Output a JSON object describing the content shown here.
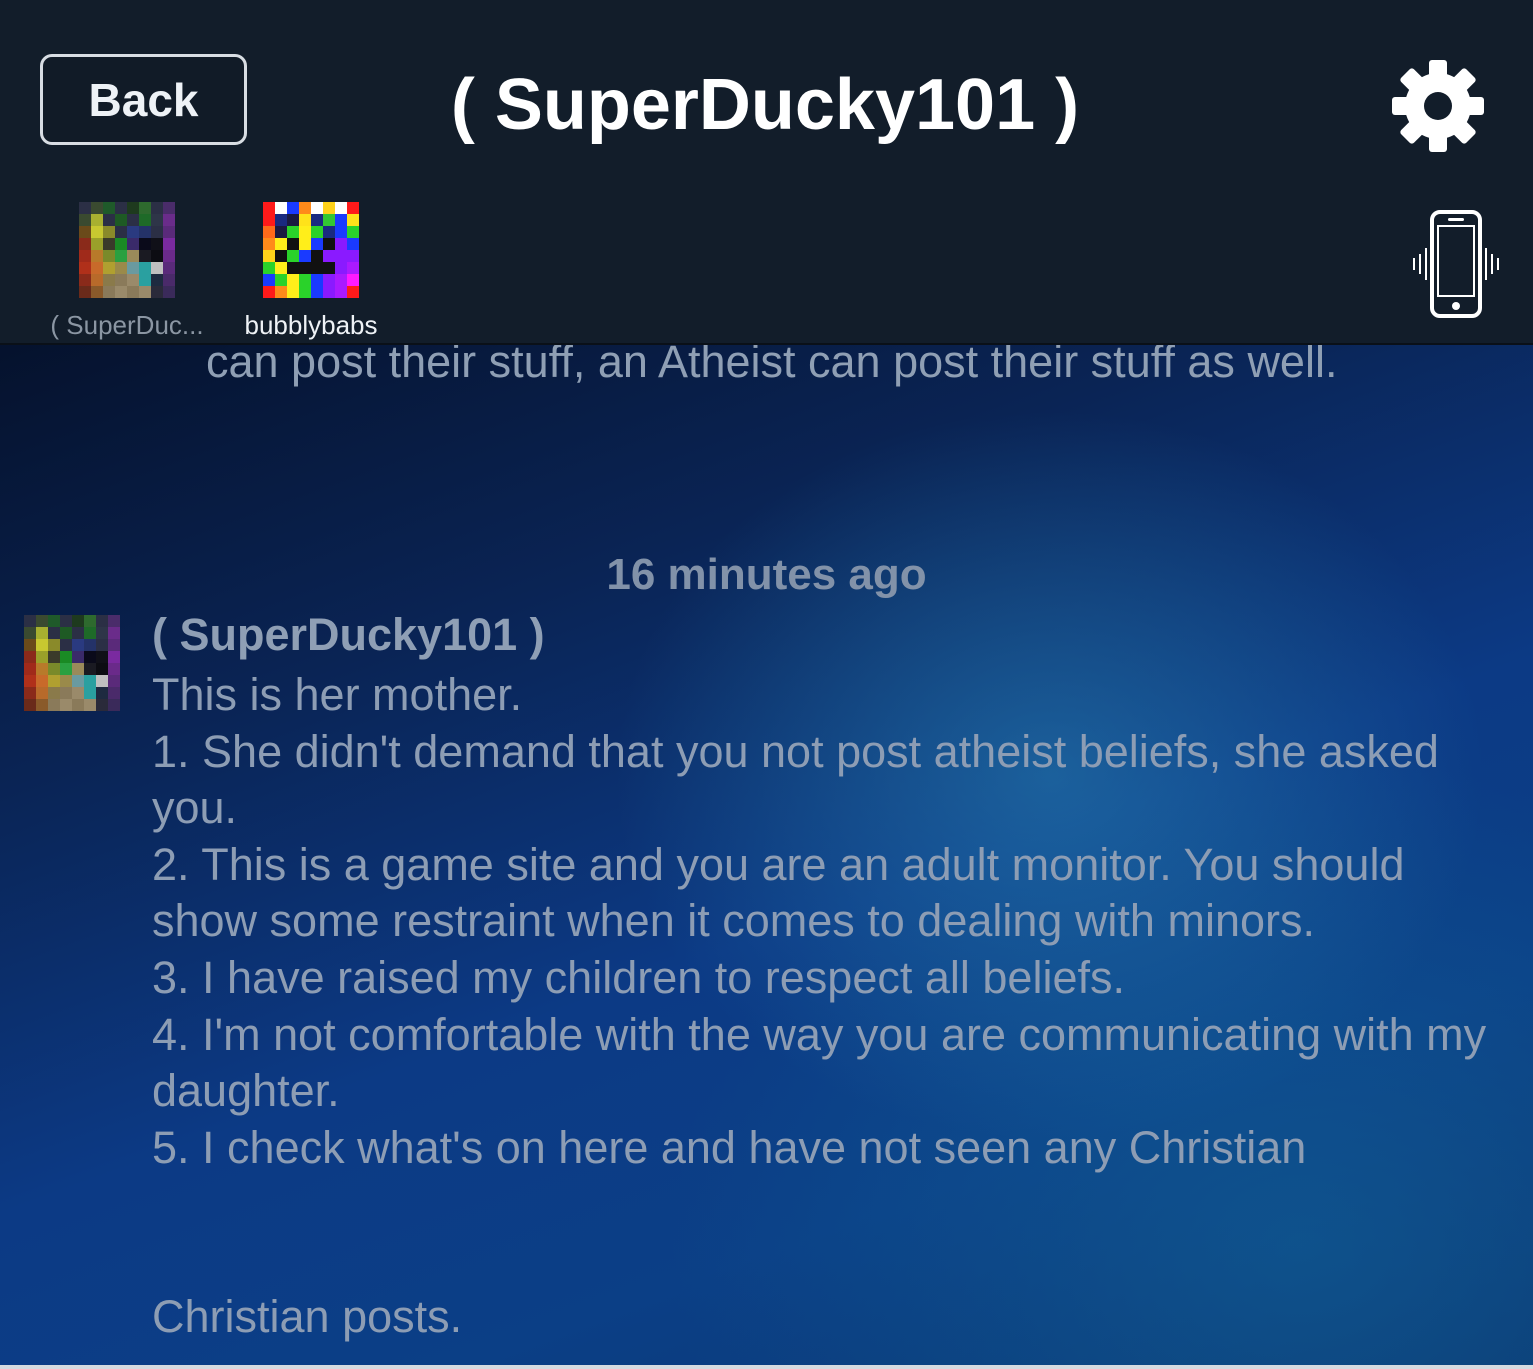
{
  "header": {
    "back_label": "Back",
    "title": "( SuperDucky101 )",
    "settings_icon": "gear-icon",
    "vibrate_icon": "phone-vibrate-icon"
  },
  "participants": [
    {
      "name": "( SuperDuc...",
      "avatar": "pixel-avatar-dark"
    },
    {
      "name": "bubblybabs",
      "avatar": "pixel-avatar-rainbow"
    }
  ],
  "chat": {
    "previous_message_tail": "can post their stuff, an Atheist can post their stuff as well.",
    "timestamp": "16 minutes ago",
    "message": {
      "sender": "( SuperDucky101 )",
      "lines": [
        "This is her mother.",
        "1. She didn't demand that you not post atheist beliefs, she asked you.",
        "2. This is a game site and you are an adult monitor. You should show some restraint when it comes to dealing with minors.",
        "3. I have raised my children to respect all beliefs.",
        "4. I'm not comfortable with the way you are communicating with my daughter.",
        "5. I check what's on here and have not seen any Christian"
      ],
      "continuation": "Christian posts."
    }
  },
  "colors": {
    "header_bg": "#121d2a",
    "text_muted": "#8d9db4",
    "accent_white": "#ffffff"
  }
}
